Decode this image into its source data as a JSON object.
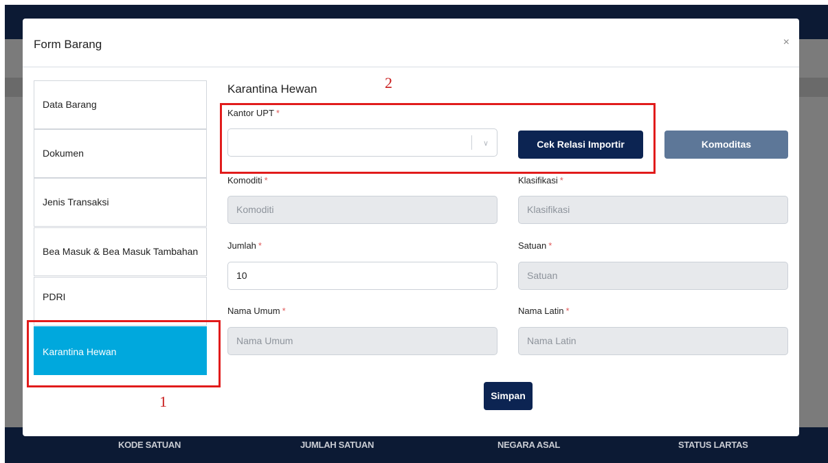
{
  "background": {
    "footer_columns": [
      "KODE SATUAN",
      "JUMLAH SATUAN",
      "NEGARA ASAL",
      "STATUS LARTAS"
    ]
  },
  "modal": {
    "title": "Form Barang",
    "close_glyph": "×"
  },
  "sidebar": {
    "items": [
      {
        "label": "Data Barang",
        "active": false
      },
      {
        "label": "Dokumen",
        "active": false
      },
      {
        "label": "Jenis Transaksi",
        "active": false
      },
      {
        "label": "Bea Masuk & Bea Masuk Tambahan",
        "active": false
      },
      {
        "label": "PDRI",
        "active": false
      },
      {
        "label": "Karantina Hewan",
        "active": true
      }
    ]
  },
  "form": {
    "section_title": "Karantina Hewan",
    "required_mark": "*",
    "kantor_upt": {
      "label": "Kantor UPT",
      "value": ""
    },
    "cek_relasi_button": "Cek Relasi Importir",
    "komoditas_button": "Komoditas",
    "komoditi": {
      "label": "Komoditi",
      "placeholder": "Komoditi"
    },
    "klasifikasi": {
      "label": "Klasifikasi",
      "placeholder": "Klasifikasi"
    },
    "jumlah": {
      "label": "Jumlah",
      "value": "10"
    },
    "satuan": {
      "label": "Satuan",
      "placeholder": "Satuan"
    },
    "nama_umum": {
      "label": "Nama Umum",
      "placeholder": "Nama Umum"
    },
    "nama_latin": {
      "label": "Nama Latin",
      "placeholder": "Nama Latin"
    },
    "simpan_button": "Simpan"
  },
  "annotations": [
    {
      "number": "1"
    },
    {
      "number": "2"
    }
  ],
  "colors": {
    "active_tab": "#00a8dd",
    "primary_button": "#0c2452",
    "secondary_button": "#5d7798",
    "annotation": "#e11b1b",
    "required": "#e05a5a"
  }
}
